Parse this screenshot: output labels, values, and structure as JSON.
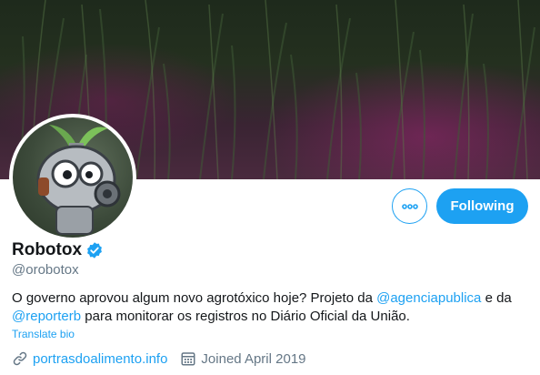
{
  "profile": {
    "display_name": "Robotox",
    "handle": "@orobotox",
    "verified": true,
    "bio": {
      "part1": "O governo aprovou algum novo agrotóxico hoje? Projeto da ",
      "mention1": "@agenciapublica",
      "part2": " e da ",
      "mention2": "@reporterb",
      "part3": " para monitorar os registros no Diário Oficial da União."
    },
    "translate_label": "Translate bio",
    "website": "portrasdoalimento.info",
    "joined": "Joined April 2019"
  },
  "actions": {
    "follow_label": "Following",
    "more_icon": "more-dots-icon"
  },
  "icons": {
    "verified": "verified-badge-icon",
    "link": "link-icon",
    "calendar": "calendar-icon"
  },
  "colors": {
    "accent": "#1da1f2",
    "secondary_text": "#657786",
    "primary_text": "#14171a"
  }
}
